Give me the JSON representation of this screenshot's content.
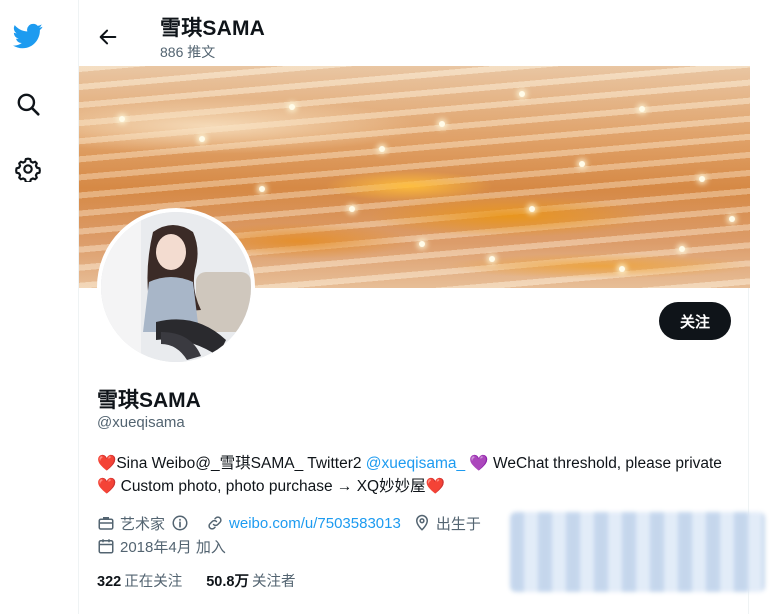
{
  "nav": {
    "icons": [
      "twitter-logo-icon",
      "search-icon",
      "settings-icon"
    ]
  },
  "header": {
    "title": "雪琪SAMA",
    "tweet_count": "886 推文"
  },
  "profile": {
    "display_name": "雪琪SAMA",
    "handle": "@xueqisama",
    "follow_label": "关注",
    "bio": {
      "heart1": "❤️",
      "part1": "Sina Weibo@_雪琪SAMA_ Twitter2 ",
      "mention": "@xueqisama_",
      "heart_purple": " 💜 ",
      "part2": "WeChat threshold, please private ",
      "heart2": "❤️",
      "part3": " Custom photo, photo purchase → XQ妙妙屋",
      "heart3": "❤️"
    },
    "category": "艺术家",
    "link": "weibo.com/u/7503583013",
    "location_partial": "出生于",
    "joined": "2018年4月 加入",
    "following_count": "322",
    "following_label": "正在关注",
    "followers_count": "50.8万",
    "followers_label": "关注者"
  },
  "colors": {
    "accent": "#1d9bf0",
    "text": "#0f1419",
    "muted": "#536471",
    "button_bg": "#0f1419"
  }
}
